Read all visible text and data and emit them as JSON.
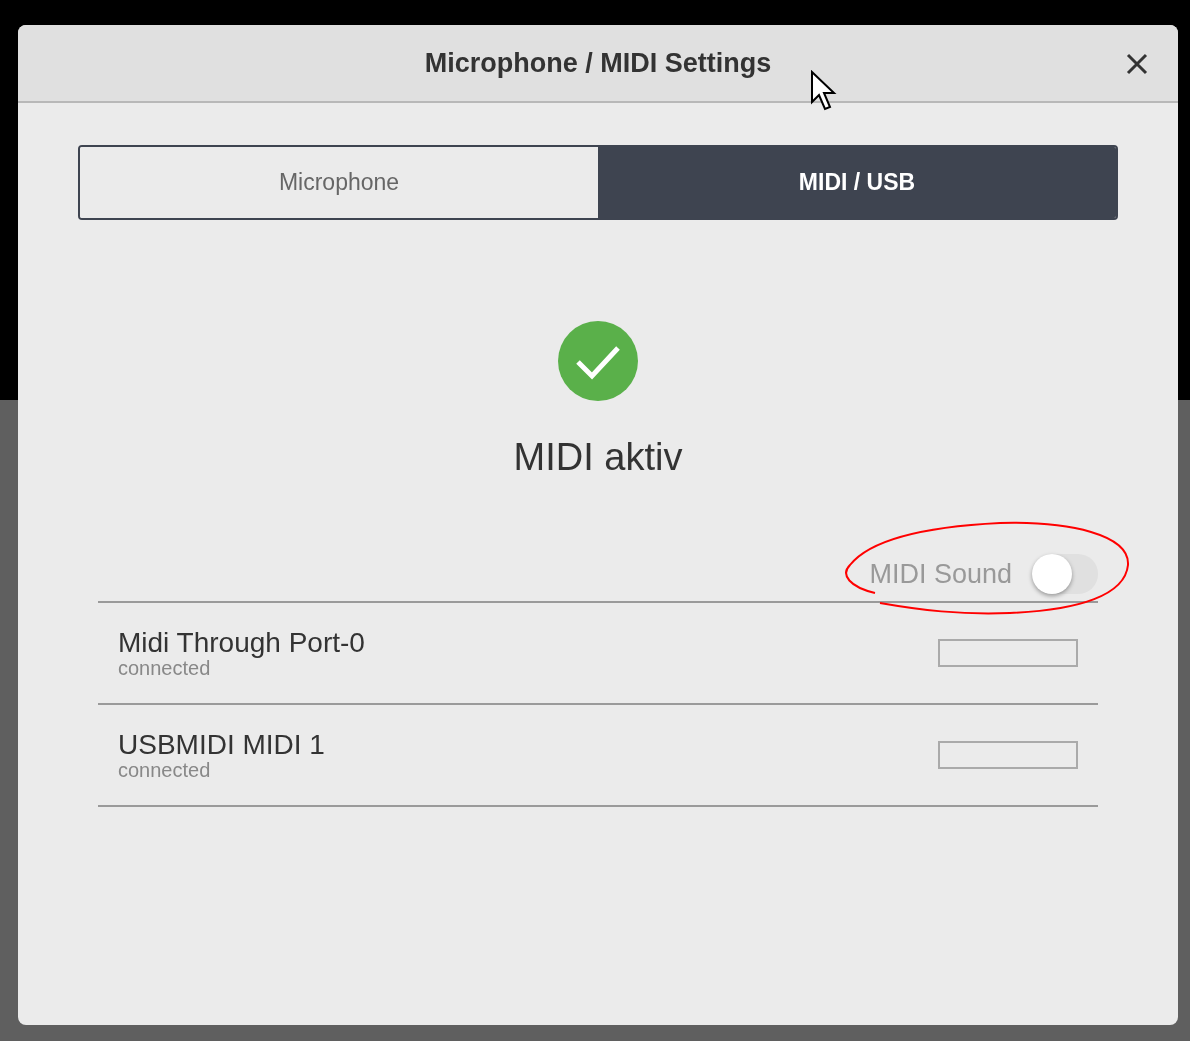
{
  "window": {
    "title": "Microphone / MIDI Settings"
  },
  "tabs": [
    {
      "label": "Microphone",
      "selected": false
    },
    {
      "label": "MIDI / USB",
      "selected": true
    }
  ],
  "status": {
    "kind": "ok",
    "text": "MIDI aktiv"
  },
  "toggle": {
    "label": "MIDI Sound",
    "on": false
  },
  "devices": [
    {
      "name": "Midi Through Port-0",
      "status": "connected"
    },
    {
      "name": "USBMIDI MIDI 1",
      "status": "connected"
    }
  ]
}
